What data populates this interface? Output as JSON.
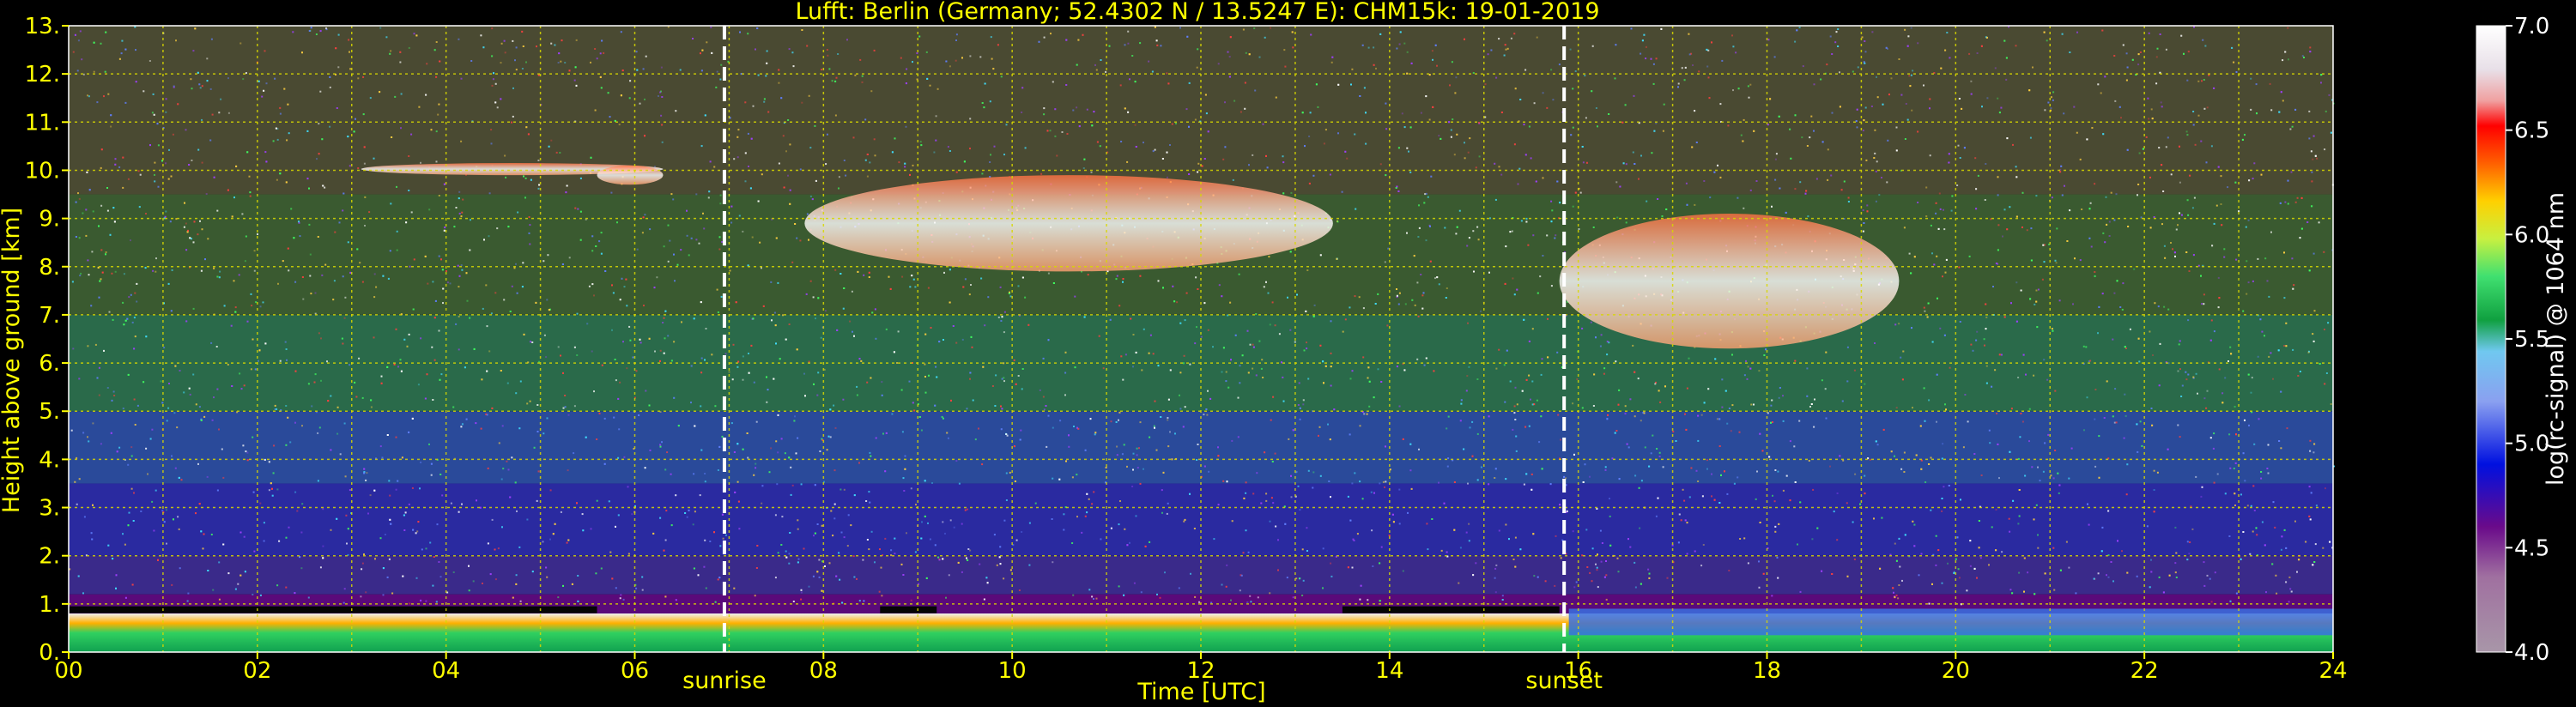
{
  "chart_data": {
    "type": "heatmap",
    "title": "Lufft: Berlin (Germany; 52.4302 N / 13.5247 E):    CHM15k: 19-01-2019",
    "xlabel": "Time [UTC]",
    "ylabel": "Height above ground [km]",
    "x_ticks": [
      "00",
      "02",
      "04",
      "06",
      "08",
      "10",
      "12",
      "14",
      "16",
      "18",
      "20",
      "22",
      "24"
    ],
    "y_ticks": [
      "0.",
      "1.",
      "2.",
      "3.",
      "4.",
      "5.",
      "6.",
      "7.",
      "8.",
      "9.",
      "10.",
      "11.",
      "12.",
      "13."
    ],
    "xlim": [
      0,
      24
    ],
    "ylim": [
      0,
      13
    ],
    "grid": true,
    "colorbar": {
      "label": "log(rc-signal) @ 1064 nm",
      "ticks": [
        "4.0",
        "4.5",
        "5.0",
        "5.5",
        "6.0",
        "6.5",
        "7.0"
      ],
      "range": [
        4.0,
        7.0
      ]
    },
    "events": [
      {
        "label": "sunrise",
        "time": 6.95
      },
      {
        "label": "sunset",
        "time": 15.85
      }
    ],
    "cloud_layers": [
      {
        "t0": 3.1,
        "t1": 6.3,
        "h0": 9.9,
        "h1": 10.15
      },
      {
        "t0": 5.6,
        "t1": 6.3,
        "h0": 9.7,
        "h1": 10.1
      },
      {
        "t0": 7.8,
        "t1": 13.4,
        "h0": 7.9,
        "h1": 9.9
      },
      {
        "t0": 15.8,
        "t1": 19.4,
        "h0": 6.3,
        "h1": 9.1
      }
    ],
    "boundary_layer_top_km": 0.8,
    "background_log_signal": 5.0
  },
  "colors": {
    "text": "#ffff00",
    "grid": "#d8d800",
    "background": "#000000",
    "event_line": "#ffffff"
  }
}
